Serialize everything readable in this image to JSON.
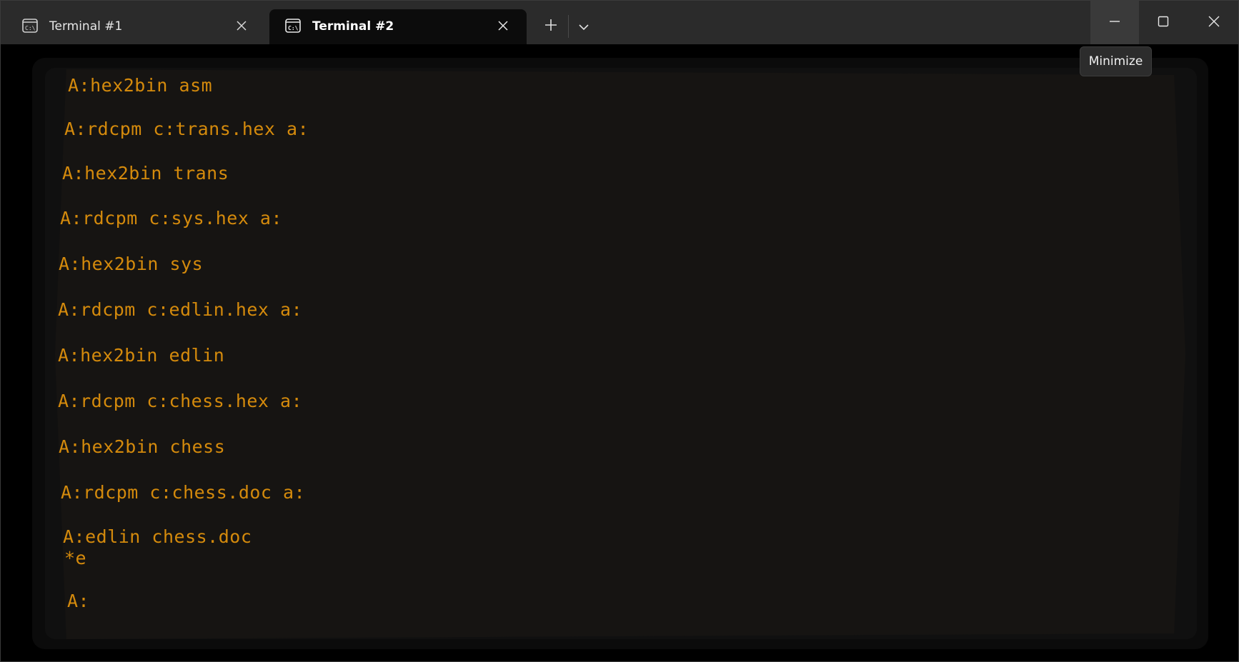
{
  "tabs": [
    {
      "title": "Terminal #1",
      "active": false
    },
    {
      "title": "Terminal #2",
      "active": true
    }
  ],
  "icons": {
    "tab": "command-prompt-icon",
    "close": "close-icon",
    "new_tab": "plus-icon",
    "dropdown": "chevron-down-icon",
    "minimize": "minimize-icon",
    "maximize": "maximize-icon",
    "window_close": "close-icon"
  },
  "tooltip": {
    "text": "Minimize"
  },
  "terminal": {
    "text_color": "#d48a0c",
    "lines": [
      "A:hex2bin asm",
      "A:rdcpm c:trans.hex a:",
      "A:hex2bin trans",
      "A:rdcpm c:sys.hex a:",
      "A:hex2bin sys",
      "A:rdcpm c:edlin.hex a:",
      "A:hex2bin edlin",
      "A:rdcpm c:chess.hex a:",
      "A:hex2bin chess",
      "A:rdcpm c:chess.doc a:",
      "A:edlin chess.doc",
      "*e",
      "A:"
    ]
  }
}
